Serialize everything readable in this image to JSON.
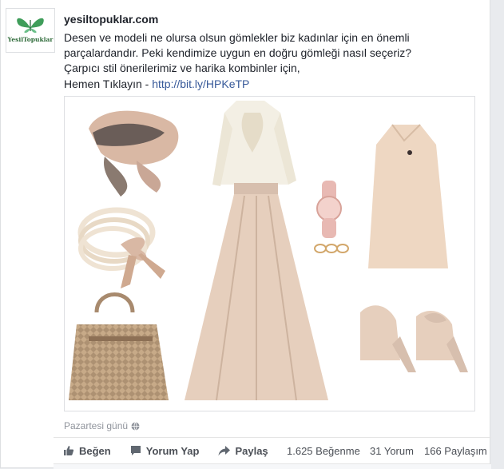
{
  "post": {
    "page_name": "yesiltopuklar.com",
    "avatar_text": "YesilTopuklar",
    "text_lines": [
      "Desen ve modeli ne olursa olsun gömlekler biz kadınlar için en önemli",
      "parçalardandır. Peki kendimize uygun en doğru gömleği nasıl seçeriz?",
      "Çarpıcı stil önerilerimiz ve harika kombinler için,"
    ],
    "cta_prefix": "Hemen Tıklayın - ",
    "cta_link": "http://bit.ly/HPKeTP",
    "timestamp": "Pazartesi günü"
  },
  "actions": {
    "like": "Beğen",
    "comment": "Yorum Yap",
    "share": "Paylaş"
  },
  "stats": {
    "likes": "1.625 Beğenme",
    "comments": "31 Yorum",
    "shares": "166 Paylaşım"
  },
  "colors": {
    "link": "#365899",
    "text": "#1d2129",
    "muted": "#90949c",
    "beige": "#e6cfbd",
    "cream": "#f3efe4"
  }
}
